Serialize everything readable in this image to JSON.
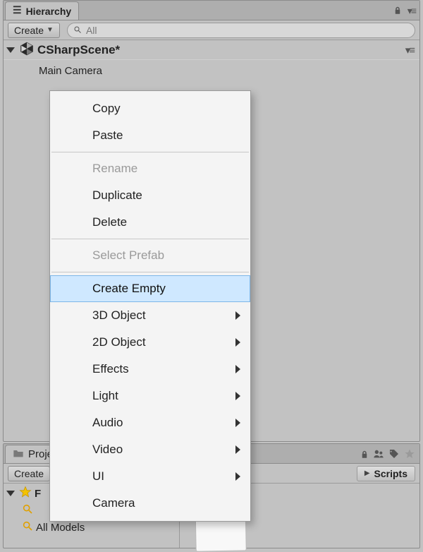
{
  "hierarchy": {
    "tab_label": "Hierarchy",
    "create_label": "Create",
    "search_filter": "All",
    "scene_name": "CSharpScene*",
    "items": [
      "Main Camera"
    ]
  },
  "context_menu": {
    "items": [
      {
        "label": "Copy",
        "enabled": true,
        "submenu": false,
        "selected": false
      },
      {
        "label": "Paste",
        "enabled": true,
        "submenu": false,
        "selected": false
      },
      {
        "separator": true
      },
      {
        "label": "Rename",
        "enabled": false,
        "submenu": false,
        "selected": false
      },
      {
        "label": "Duplicate",
        "enabled": true,
        "submenu": false,
        "selected": false
      },
      {
        "label": "Delete",
        "enabled": true,
        "submenu": false,
        "selected": false
      },
      {
        "separator": true
      },
      {
        "label": "Select Prefab",
        "enabled": false,
        "submenu": false,
        "selected": false
      },
      {
        "separator": true
      },
      {
        "label": "Create Empty",
        "enabled": true,
        "submenu": false,
        "selected": true
      },
      {
        "label": "3D Object",
        "enabled": true,
        "submenu": true,
        "selected": false
      },
      {
        "label": "2D Object",
        "enabled": true,
        "submenu": true,
        "selected": false
      },
      {
        "label": "Effects",
        "enabled": true,
        "submenu": true,
        "selected": false
      },
      {
        "label": "Light",
        "enabled": true,
        "submenu": true,
        "selected": false
      },
      {
        "label": "Audio",
        "enabled": true,
        "submenu": true,
        "selected": false
      },
      {
        "label": "Video",
        "enabled": true,
        "submenu": true,
        "selected": false
      },
      {
        "label": "UI",
        "enabled": true,
        "submenu": true,
        "selected": false
      },
      {
        "label": "Camera",
        "enabled": true,
        "submenu": false,
        "selected": false
      }
    ]
  },
  "project": {
    "tab_label": "Project",
    "create_label": "Create",
    "breadcrumb": "Scripts",
    "favorites_label": "Favorites",
    "fav_items": [
      "All Models"
    ],
    "partial_fav_label": "F"
  }
}
